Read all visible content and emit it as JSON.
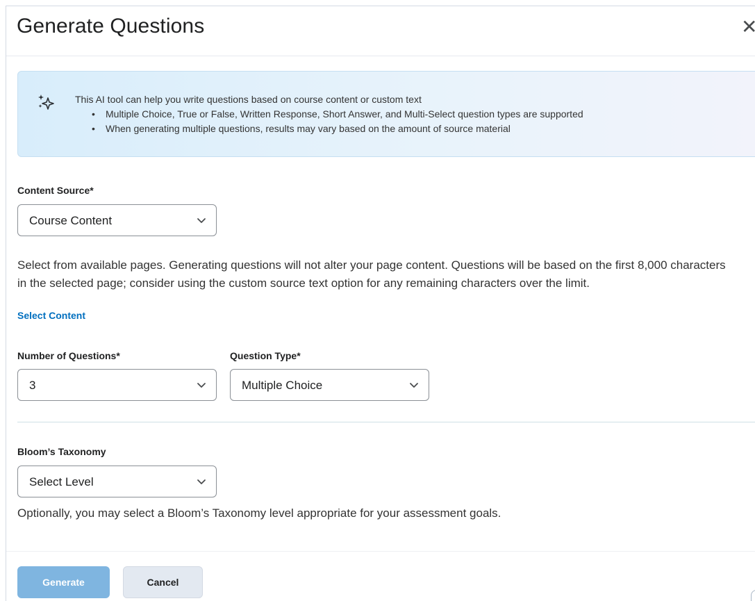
{
  "dialog": {
    "title": "Generate Questions",
    "close_icon": "close-icon"
  },
  "info": {
    "icon": "sparkle-icon",
    "intro": "This AI tool can help you write questions based on course content or custom text",
    "bullets": [
      "Multiple Choice, True or False, Written Response, Short Answer, and Multi-Select question types are supported",
      "When generating multiple questions, results may vary based on the amount of source material"
    ]
  },
  "content_source": {
    "label": "Content Source*",
    "value": "Course Content"
  },
  "description": {
    "line1": "Select from available pages. Generating questions will not alter your page content. Questions will be based on the first 8,000 characters",
    "line2": "in the selected page; consider using the custom source text option for any remaining characters over the limit."
  },
  "select_content_link": "Select Content",
  "num_questions": {
    "label": "Number of Questions*",
    "value": "3"
  },
  "question_type": {
    "label": "Question Type*",
    "value": "Multiple Choice"
  },
  "blooms": {
    "label": "Bloom’s Taxonomy",
    "value": "Select Level",
    "help": "Optionally, you may select a Bloom’s Taxonomy level appropriate for your assessment goals."
  },
  "footer": {
    "generate_label": "Generate",
    "cancel_label": "Cancel"
  },
  "colors": {
    "link": "#006fbf",
    "primary_disabled": "#7fb5e0",
    "info_bg": "#d8edfb"
  }
}
